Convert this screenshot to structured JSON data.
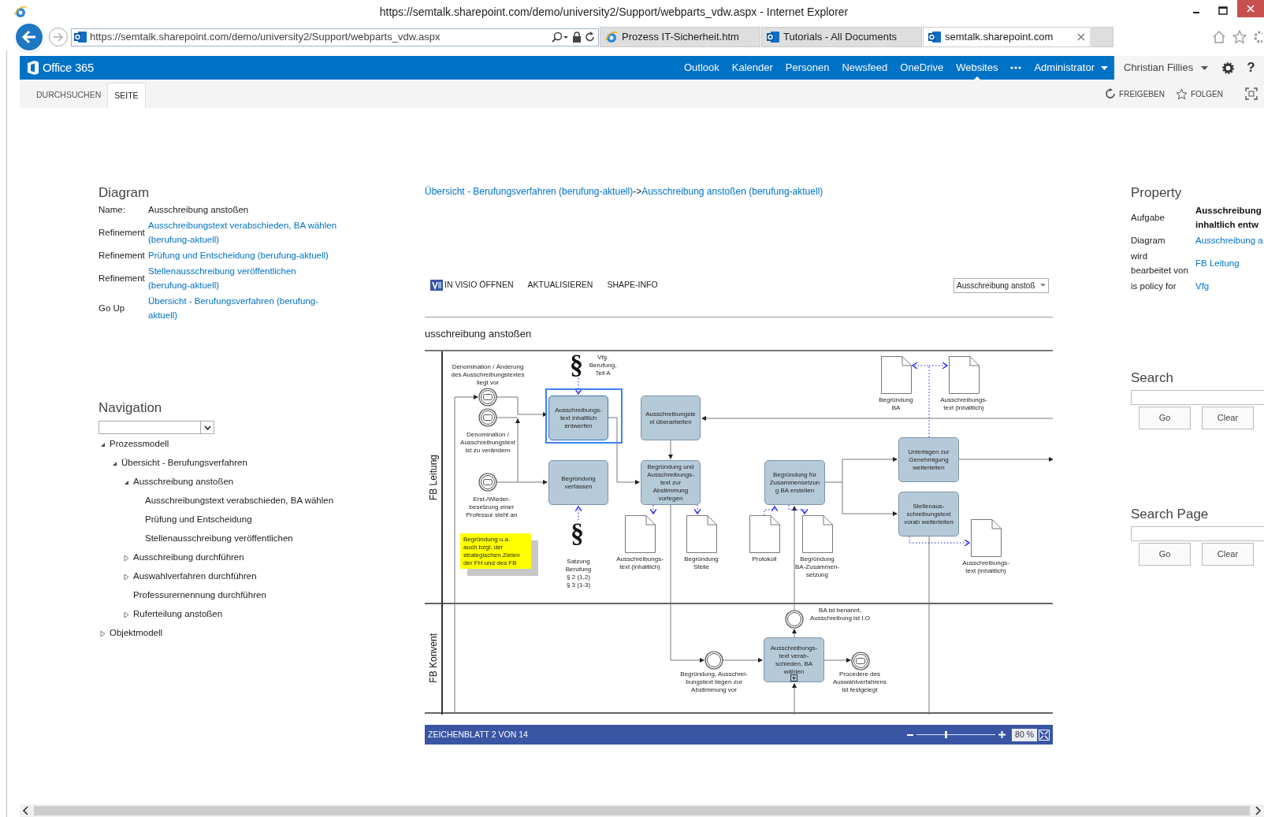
{
  "window": {
    "title": "https://semtalk.sharepoint.com/demo/university2/Support/webparts_vdw.aspx - Internet Explorer"
  },
  "address_bar": {
    "value": "https://semtalk.sharepoint.com/demo/university2/Support/webparts_vdw.aspx"
  },
  "browser_tabs": [
    {
      "label": "Prozess IT-Sicherheit.htm",
      "selected": false
    },
    {
      "label": "Tutorials - All Documents",
      "selected": false
    },
    {
      "label": "semtalk.sharepoint.com",
      "selected": true
    }
  ],
  "suite_bar": {
    "brand": "Office 365",
    "links": [
      {
        "label": "Outlook",
        "selected": false
      },
      {
        "label": "Kalender",
        "selected": false
      },
      {
        "label": "Personen",
        "selected": false
      },
      {
        "label": "Newsfeed",
        "selected": false
      },
      {
        "label": "OneDrive",
        "selected": false
      },
      {
        "label": "Websites",
        "selected": true
      }
    ],
    "admin": "Administrator",
    "user": "Christian Fillies",
    "help": "?"
  },
  "ribbon": {
    "tabs": [
      {
        "label": "DURCHSUCHEN",
        "selected": false
      },
      {
        "label": "SEITE",
        "selected": true
      }
    ],
    "actions": [
      "FREIGEBEN",
      "FOLGEN"
    ]
  },
  "diagram_info": {
    "title": "Diagram",
    "rows": [
      {
        "label": "Name:",
        "value": "Ausschreibung anstoßen",
        "kind": "text"
      },
      {
        "label": "Refinement",
        "value": "Ausschreibungstext verabschieden, BA wählen (berufung-aktuell)",
        "kind": "link"
      },
      {
        "label": "Refinement",
        "value": "Prüfung und Entscheidung (berufung-aktuell)",
        "kind": "link"
      },
      {
        "label": "Refinement",
        "value": "Stellenausschreibung veröffentlichen (berufung-aktuell)",
        "kind": "link"
      },
      {
        "label": "Go Up",
        "value": "Übersicht - Berufungsverfahren (berufung-aktuell)",
        "kind": "link"
      }
    ]
  },
  "navigation": {
    "title": "Navigation",
    "tree": [
      {
        "label": "Prozessmodell",
        "expanded": true,
        "children": [
          {
            "label": "Übersicht - Berufungsverfahren",
            "expanded": true,
            "children": [
              {
                "label": "Ausschreibung anstoßen",
                "expanded": true,
                "children": [
                  {
                    "label": "Ausschreibungstext verabschieden, BA wählen"
                  },
                  {
                    "label": "Prüfung und Entscheidung"
                  },
                  {
                    "label": "Stellenausschreibung veröffentlichen"
                  }
                ]
              },
              {
                "label": "Ausschreibung durchführen",
                "expanded": false
              },
              {
                "label": "Auswahlverfahren durchführen",
                "expanded": false
              },
              {
                "label": "Professurernennung durchführen"
              },
              {
                "label": "Ruferteilung anstoßen",
                "expanded": false
              }
            ]
          }
        ]
      },
      {
        "label": "Objektmodell",
        "expanded": false
      }
    ]
  },
  "breadcrumb": {
    "links": [
      "Übersicht - Berufungsverfahren (berufung-aktuell)",
      "Ausschreibung anstoßen (berufung-aktuell)"
    ],
    "separator": "->"
  },
  "visio": {
    "actions": [
      "IN VISIO ÖFFNEN",
      "AKTUALISIEREN",
      "SHAPE-INFO"
    ],
    "page_select": "Ausschreibung anstoß",
    "page_title": "usschreibung anstoßen",
    "lanes": [
      {
        "label": "FB Leitung"
      },
      {
        "label": "FB Konvent"
      }
    ],
    "nodes": [
      {
        "kind": "event",
        "label": "Denomination / Änderung\ndes Ausschreibungstextes\nliegt vor",
        "message": true
      },
      {
        "kind": "event",
        "label": "Denomination /\nAusschreibungstext\nist zu verändern",
        "message": true
      },
      {
        "kind": "event",
        "label": "Erst-/Wieder-\nbesetzung einer\nProfessur steht an",
        "message": true
      },
      {
        "kind": "paragraph",
        "symbol": "§",
        "label": "Vfg.\nBerufung,\nTeil A"
      },
      {
        "kind": "task",
        "label": "Ausschreibungs-\ntext inhaltlich\nentwerfen",
        "selected": true
      },
      {
        "kind": "task",
        "label": "Ausschreibungste\nxt überarbeiten",
        "selected": false
      },
      {
        "kind": "task",
        "label": "Begründung\nverfassen",
        "selected": false
      },
      {
        "kind": "task",
        "label": "Begründung und\nAusschreibungs-\ntext zur\nAbstimmung\nvorlegen",
        "selected": false
      },
      {
        "kind": "paragraph",
        "symbol": "§",
        "label": "Satzung\nBerufung\n§ 2 (1,2)\n§ 3 (1-3)"
      },
      {
        "kind": "note",
        "label": "Begründung u.a.\nauch bzgl. der\nstrategischen Zielen\nder FH und des FB"
      },
      {
        "kind": "document",
        "label": "Ausschreibungs-\ntext (inhaltlich)"
      },
      {
        "kind": "document",
        "label": "Begründung\nStelle"
      },
      {
        "kind": "document",
        "label": "Protokoll"
      },
      {
        "kind": "document",
        "label": "Begründung\nBA-Zusammen-\nsetzung"
      },
      {
        "kind": "task",
        "label": "Begründung für\nZusammensetzun\ng BA erstellen",
        "selected": false
      },
      {
        "kind": "document",
        "label": "Begründung\nBA"
      },
      {
        "kind": "document",
        "label": "Ausschreibungs-\ntext (inhaltlich)"
      },
      {
        "kind": "task",
        "label": "Unterlagen zur\nGenehmigung\nweiterleiten",
        "selected": false
      },
      {
        "kind": "task",
        "label": "Stellenaus-\nschreibungstext\nvorab weiterleiten",
        "selected": false
      },
      {
        "kind": "document",
        "label": "Ausschreibungs-\ntext (inhaltlich)"
      },
      {
        "kind": "event",
        "label": "BA ist benannt,\nAusschreibung ist I.O",
        "message": false
      },
      {
        "kind": "event",
        "label": "Begründung, Ausschrei-\nbungstext liegen zur\nAbstimmung vor",
        "message": false
      },
      {
        "kind": "task",
        "label": "Ausschreibungs-\ntext verab-\nschieden, BA\nwählen",
        "selected": false,
        "subprocess": true
      },
      {
        "kind": "event",
        "label": "Procedere des\nAuswahlverfahrens\nist festgelegt",
        "message": true
      }
    ],
    "status_bar": {
      "page": "ZEICHENBLATT 2 VON 14",
      "zoom": {
        "level": 0.37,
        "reading": "80 %"
      }
    }
  },
  "property": {
    "title": "Property",
    "rows": [
      {
        "label": "Aufgabe",
        "value": "Ausschreibung\ninhaltlich entw",
        "kind": "text"
      },
      {
        "label": "Diagram",
        "value": "Ausschreibung a",
        "kind": "link"
      },
      {
        "label": "wird\nbearbeitet von",
        "value": "FB Leitung",
        "kind": "link"
      },
      {
        "label": "is policy for",
        "value": "Vfg",
        "kind": "link"
      }
    ]
  },
  "search": [
    {
      "title": "Search",
      "buttons": [
        "Go",
        "Clear"
      ]
    },
    {
      "title": "Search Page",
      "buttons": [
        "Go",
        "Clear"
      ]
    }
  ]
}
